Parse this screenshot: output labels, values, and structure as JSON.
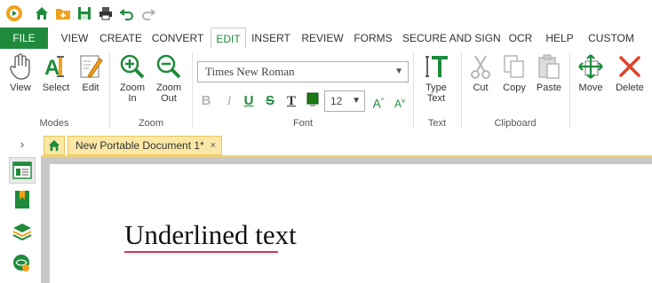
{
  "quick_access": {
    "items": [
      {
        "icon": "app-logo-icon"
      },
      {
        "icon": "home-icon"
      },
      {
        "icon": "open-folder-icon"
      },
      {
        "icon": "save-icon"
      },
      {
        "icon": "print-icon"
      },
      {
        "icon": "undo-icon"
      },
      {
        "icon": "redo-icon"
      }
    ]
  },
  "menu_tabs": [
    "FILE",
    "VIEW",
    "CREATE",
    "CONVERT",
    "EDIT",
    "INSERT",
    "REVIEW",
    "FORMS",
    "SECURE AND SIGN",
    "OCR",
    "HELP",
    "CUSTOM"
  ],
  "active_tab": "EDIT",
  "ribbon": {
    "modes": {
      "label": "Modes",
      "view": "View",
      "select": "Select",
      "edit": "Edit"
    },
    "zoom": {
      "label": "Zoom",
      "zoom_in_1": "Zoom",
      "zoom_in_2": "In",
      "zoom_out_1": "Zoom",
      "zoom_out_2": "Out"
    },
    "font": {
      "label": "Font",
      "family": "Times New Roman",
      "size": "12",
      "bold": "B",
      "italic": "I",
      "underline": "U",
      "strike": "S",
      "text_color": "T",
      "grow": "A",
      "shrink": "A"
    },
    "text": {
      "label": "Text",
      "type_text_1": "Type",
      "type_text_2": "Text"
    },
    "clipboard": {
      "label": "Clipboard",
      "cut": "Cut",
      "copy": "Copy",
      "paste": "Paste"
    },
    "edit2": {
      "move": "Move",
      "delete": "Delete"
    }
  },
  "document": {
    "tab_title": "New Portable Document 1*",
    "close": "×",
    "content_text": "Underlined text"
  },
  "colors": {
    "accent_green": "#1f8a3c",
    "tab_yellow": "#fbe8a6",
    "underline_red": "#e0305a"
  }
}
